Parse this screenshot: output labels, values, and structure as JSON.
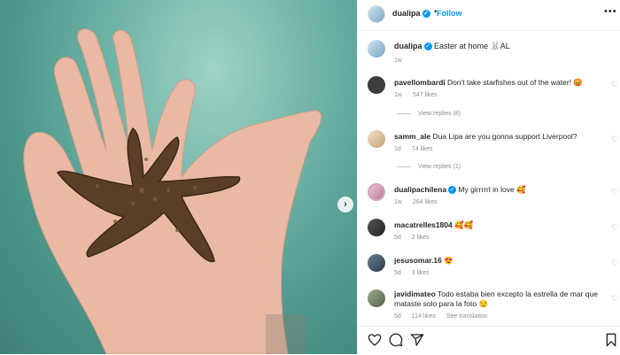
{
  "post": {
    "username": "dualipa",
    "follow_label": "Follow",
    "separator": "•",
    "more": "•••",
    "caption": "Easter at home 🐰AL",
    "caption_time": "1w"
  },
  "comments": [
    {
      "user": "pavellombardi",
      "text": "Don't take starfishes out of the water! 😡",
      "time": "1w",
      "likes": "547 likes",
      "replies": "View replies (8)"
    },
    {
      "user": "samm_ale",
      "text": "Dua Lipa are you gonna support Liverpool?",
      "time": "1d",
      "likes": "74 likes",
      "replies": "View replies (1)"
    },
    {
      "user": "dualipachilena",
      "text": "My girrrrrl in love 🥰",
      "time": "1w",
      "likes": "284 likes",
      "verified": true
    },
    {
      "user": "macatrelles1804",
      "text": "🥰🥰",
      "time": "5d",
      "likes": "2 likes"
    },
    {
      "user": "jesusomar.16",
      "text": "😍",
      "time": "5d",
      "likes": "3 likes"
    },
    {
      "user": "javidimateo",
      "text": "Todo estaba bien excepto la estrella de mar que mataste solo para la foto 😒",
      "time": "5d",
      "likes": "114 likes",
      "extra": "See translation"
    }
  ],
  "icons": {
    "next": "›",
    "heart": "♡",
    "verified": "✓"
  },
  "colors": {
    "accent": "#0095f6",
    "muted": "#8e8e8e",
    "water": "#6fb3a6"
  }
}
